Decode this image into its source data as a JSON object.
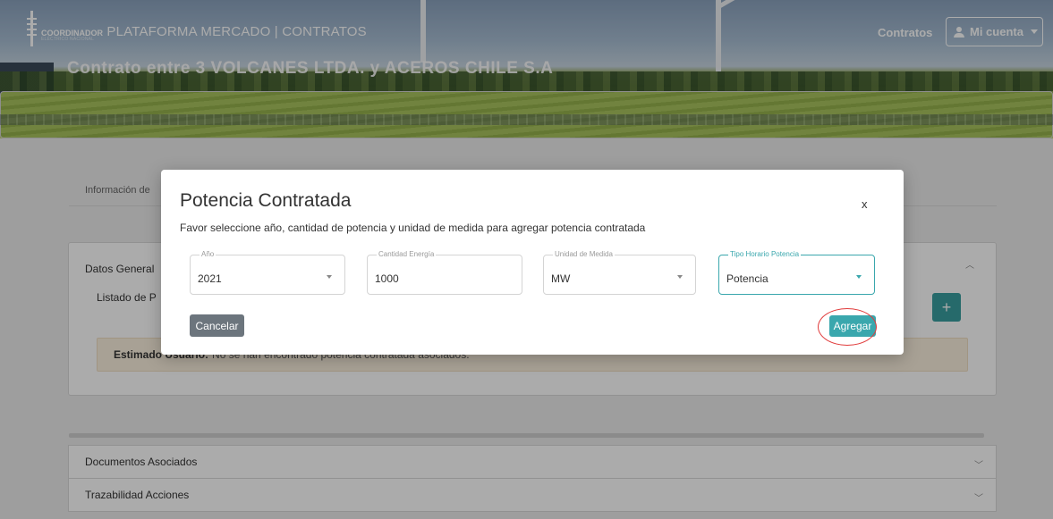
{
  "header": {
    "brand_small": "COORDINADOR",
    "brand_tagline": "ELÉCTRICO NACIONAL",
    "brand_title": "PLATAFORMA MERCADO | CONTRATOS",
    "nav_contracts": "Contratos",
    "account_label": "Mi cuenta"
  },
  "hero": {
    "contract_title": "Contrato entre 3 VOLCANES LTDA. y ACEROS CHILE S.A"
  },
  "page": {
    "tab_info": "Información de",
    "card_title": "Datos General",
    "card_subtitle": "Listado de P",
    "add_symbol": "+",
    "alert_bold": "Estimado Usuario:",
    "alert_text": "No se han encontrado potencia contratada asociados.",
    "accordions": [
      {
        "label": "Documentos Asociados"
      },
      {
        "label": "Trazabilidad Acciones"
      }
    ]
  },
  "modal": {
    "title": "Potencia Contratada",
    "close": "x",
    "subtitle": "Favor seleccione año, cantidad de potencia y unidad de medida para agregar potencia contratada",
    "fields": {
      "year": {
        "label": "Año",
        "value": "2021"
      },
      "amount": {
        "label": "Cantidad Energía",
        "value": "1000"
      },
      "unit": {
        "label": "Unidad de Medida",
        "value": "MW"
      },
      "type": {
        "label": "Tipo Horario Potencia",
        "value": "Potencia"
      }
    },
    "cancel_label": "Cancelar",
    "add_label": "Agregar"
  },
  "colors": {
    "accent": "#3aa7ad",
    "cancel": "#6c757d",
    "highlight": "#e03a3a",
    "alert_bg": "#fbf0de"
  }
}
